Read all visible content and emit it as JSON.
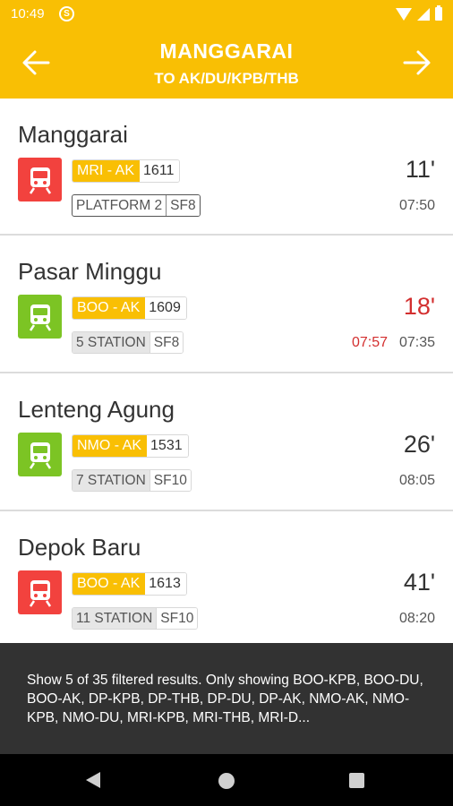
{
  "status_bar": {
    "time": "10:49",
    "sync_icon": "sync-icon"
  },
  "header": {
    "title": "MANGGARAI",
    "subtitle": "TO AK/DU/KPB/THB"
  },
  "trains": [
    {
      "station": "Manggarai",
      "icon_color": "#f2423e",
      "route": "MRI - AK",
      "train_no": "1611",
      "info_main": "PLATFORM 2",
      "info_sf": "SF8",
      "info_style": "platform",
      "minutes": "11'",
      "minutes_late": false,
      "delay_time": "",
      "time": "07:50"
    },
    {
      "station": "Pasar Minggu",
      "icon_color": "#7cc424",
      "route": "BOO - AK",
      "train_no": "1609",
      "info_main": "5 STATION",
      "info_sf": "SF8",
      "info_style": "station",
      "minutes": "18'",
      "minutes_late": true,
      "delay_time": "07:57",
      "time": "07:35"
    },
    {
      "station": "Lenteng Agung",
      "icon_color": "#7cc424",
      "route": "NMO - AK",
      "train_no": "1531",
      "info_main": "7 STATION",
      "info_sf": "SF10",
      "info_style": "station",
      "minutes": "26'",
      "minutes_late": false,
      "delay_time": "",
      "time": "08:05"
    },
    {
      "station": "Depok Baru",
      "icon_color": "#f2423e",
      "route": "BOO - AK",
      "train_no": "1613",
      "info_main": "11 STATION",
      "info_sf": "SF10",
      "info_style": "station",
      "minutes": "41'",
      "minutes_late": false,
      "delay_time": "",
      "time": "08:20"
    }
  ],
  "snackbar": {
    "message": "Show 5 of 35 filtered results. Only showing BOO-KPB, BOO-DU, BOO-AK, DP-KPB, DP-THB, DP-DU, DP-AK, NMO-AK, NMO-KPB, NMO-DU, MRI-KPB, MRI-THB, MRI-D..."
  },
  "colors": {
    "accent": "#f9bf04",
    "late": "#d32f2f",
    "snackbar_bg": "#323232"
  }
}
